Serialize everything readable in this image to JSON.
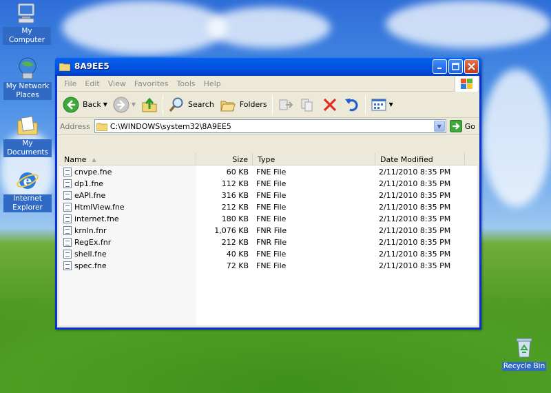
{
  "desktop": {
    "icons": [
      {
        "label": "My Computer"
      },
      {
        "label": "My Network Places"
      },
      {
        "label": "My Documents"
      },
      {
        "label": "Internet Explorer"
      },
      {
        "label": "Recycle Bin"
      }
    ]
  },
  "window": {
    "title": "8A9EE5",
    "menu": [
      "File",
      "Edit",
      "View",
      "Favorites",
      "Tools",
      "Help"
    ],
    "toolbar": {
      "back_label": "Back",
      "search_label": "Search",
      "folders_label": "Folders"
    },
    "address": {
      "label": "Address",
      "value": "C:\\WINDOWS\\system32\\8A9EE5",
      "go_label": "Go"
    },
    "columns": [
      "Name",
      "Size",
      "Type",
      "Date Modified"
    ],
    "files": [
      {
        "name": "cnvpe.fne",
        "size": "60 KB",
        "type": "FNE File",
        "modified": "2/11/2010 8:35 PM"
      },
      {
        "name": "dp1.fne",
        "size": "112 KB",
        "type": "FNE File",
        "modified": "2/11/2010 8:35 PM"
      },
      {
        "name": "eAPI.fne",
        "size": "316 KB",
        "type": "FNE File",
        "modified": "2/11/2010 8:35 PM"
      },
      {
        "name": "HtmlView.fne",
        "size": "212 KB",
        "type": "FNE File",
        "modified": "2/11/2010 8:35 PM"
      },
      {
        "name": "internet.fne",
        "size": "180 KB",
        "type": "FNE File",
        "modified": "2/11/2010 8:35 PM"
      },
      {
        "name": "krnln.fnr",
        "size": "1,076 KB",
        "type": "FNR File",
        "modified": "2/11/2010 8:35 PM"
      },
      {
        "name": "RegEx.fnr",
        "size": "212 KB",
        "type": "FNR File",
        "modified": "2/11/2010 8:35 PM"
      },
      {
        "name": "shell.fne",
        "size": "40 KB",
        "type": "FNE File",
        "modified": "2/11/2010 8:35 PM"
      },
      {
        "name": "spec.fne",
        "size": "72 KB",
        "type": "FNE File",
        "modified": "2/11/2010 8:35 PM"
      }
    ]
  },
  "colors": {
    "title_blue": "#0055e5",
    "chrome": "#ece9d8",
    "selection": "#316ac5"
  }
}
